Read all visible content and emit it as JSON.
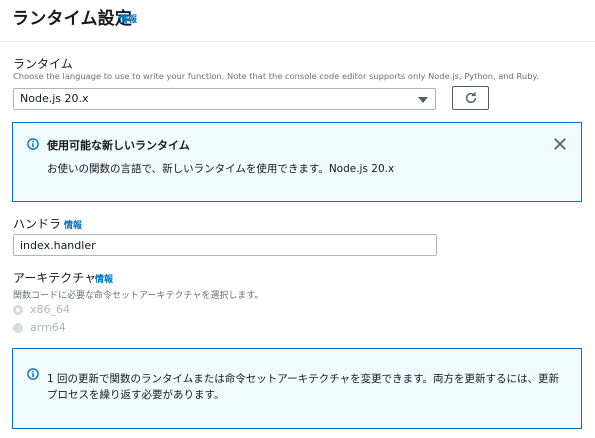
{
  "header": {
    "title": "ランタイム設定",
    "info": "情報"
  },
  "runtime": {
    "label": "ランタイム",
    "description": "Choose the language to use to write your function. Note that the console code editor supports only Node.js, Python, and Ruby.",
    "selected": "Node.js 20.x",
    "refresh_icon": "refresh-icon"
  },
  "new_runtime_alert": {
    "title": "使用可能な新しいランタイム",
    "body": "お使いの関数の言語で、新しいランタイムを使用できます。Node.js 20.x"
  },
  "handler": {
    "label": "ハンドラ",
    "info": "情報",
    "value": "index.handler"
  },
  "architecture": {
    "label": "アーキテクチャ",
    "info": "情報",
    "description": "関数コードに必要な命令セットアーキテクチャを選択します。",
    "options": [
      {
        "label": "x86_64",
        "checked": true
      },
      {
        "label": "arm64",
        "checked": false
      }
    ]
  },
  "update_alert": {
    "line1": "1 回の更新で関数のランタイムまたは命令セットアーキテクチャを変更できます。両方を更新するには、更新",
    "line2": "プロセスを繰り返す必要があります。"
  },
  "colors": {
    "link": "#0073bb",
    "alert_border": "#0073bb",
    "alert_bg": "#f1faff",
    "disabled": "#aab7b8"
  }
}
